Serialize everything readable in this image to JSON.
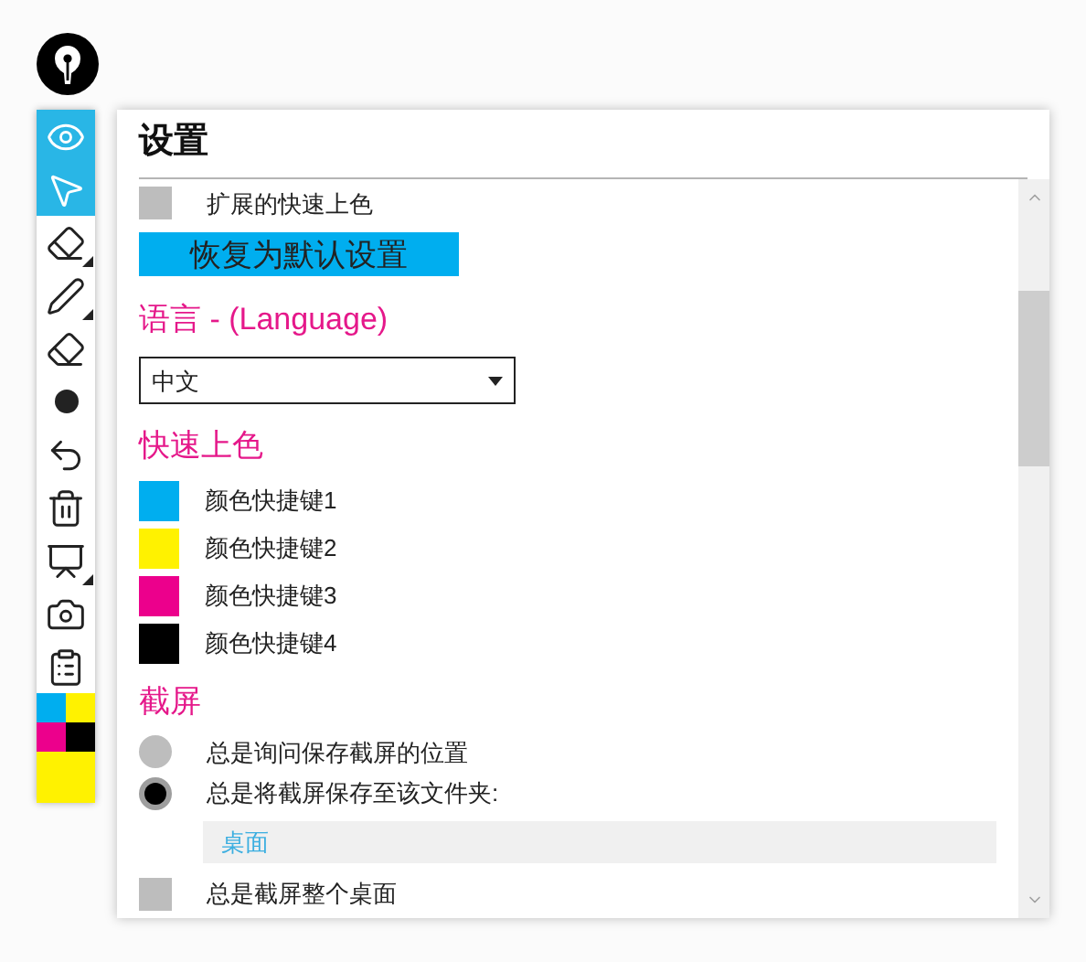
{
  "toolbar": {
    "tools": [
      {
        "kind": "eye",
        "selected": true,
        "submenu": false
      },
      {
        "kind": "pointer",
        "selected": true,
        "submenu": false
      },
      {
        "kind": "eraser",
        "selected": false,
        "submenu": true
      },
      {
        "kind": "pen",
        "selected": false,
        "submenu": true
      },
      {
        "kind": "eraser",
        "selected": false,
        "submenu": false
      },
      {
        "kind": "dot",
        "selected": false,
        "submenu": false
      },
      {
        "kind": "undo",
        "selected": false,
        "submenu": false
      },
      {
        "kind": "trash",
        "selected": false,
        "submenu": false
      },
      {
        "kind": "easel",
        "selected": false,
        "submenu": true
      },
      {
        "kind": "camera",
        "selected": false,
        "submenu": false
      },
      {
        "kind": "clipboard",
        "selected": false,
        "submenu": false
      }
    ],
    "palette": [
      {
        "color": "#00aeef"
      },
      {
        "color": "#fff200"
      },
      {
        "color": "#ec008c"
      },
      {
        "color": "#000000"
      },
      {
        "color": "#fff200"
      }
    ]
  },
  "settings": {
    "title": "设置",
    "items": [
      {
        "kind": "checkbox",
        "label": "扩展的快速上色",
        "checked": false
      },
      {
        "kind": "button",
        "label": "恢复为默认设置"
      },
      {
        "kind": "heading",
        "label": "语言 - (Language)"
      },
      {
        "kind": "dropdown",
        "value": "中文"
      },
      {
        "kind": "heading",
        "label": "快速上色"
      },
      {
        "kind": "swatch",
        "label": "颜色快捷键1",
        "color": "#00aeef"
      },
      {
        "kind": "swatch",
        "label": "颜色快捷键2",
        "color": "#fff200"
      },
      {
        "kind": "swatch",
        "label": "颜色快捷键3",
        "color": "#ec008c"
      },
      {
        "kind": "swatch",
        "label": "颜色快捷键4",
        "color": "#000000"
      },
      {
        "kind": "heading",
        "label": "截屏"
      },
      {
        "kind": "radio",
        "label": "总是询问保存截屏的位置",
        "selected": false
      },
      {
        "kind": "radio",
        "label": "总是将截屏保存至该文件夹:",
        "selected": true
      },
      {
        "kind": "field",
        "value": "桌面"
      },
      {
        "kind": "checkbox",
        "label": "总是截屏整个桌面",
        "checked": false
      }
    ]
  }
}
